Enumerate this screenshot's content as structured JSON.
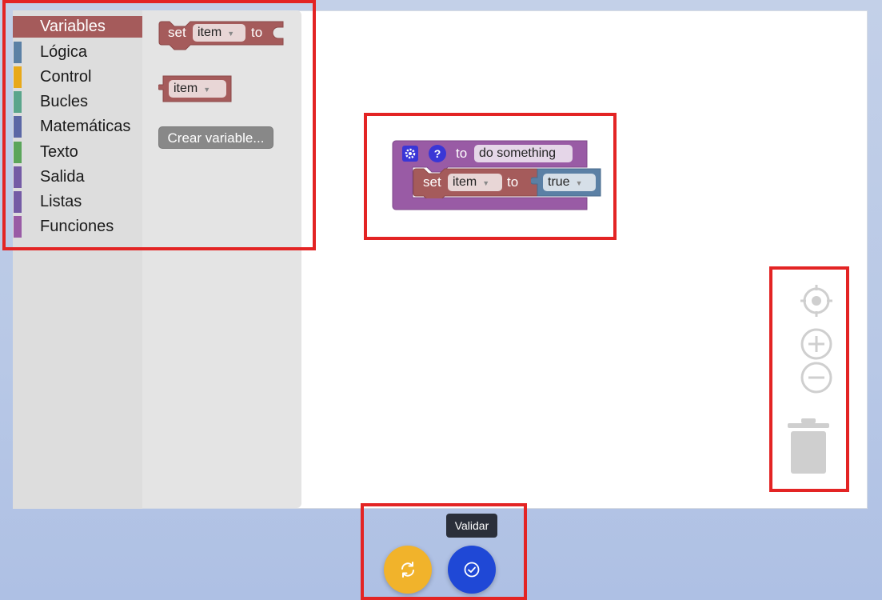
{
  "categories": [
    {
      "label": "Variables",
      "color": "#a55b5b",
      "selected": true
    },
    {
      "label": "Lógica",
      "color": "#5b80a5"
    },
    {
      "label": "Control",
      "color": "#e8a91a"
    },
    {
      "label": "Bucles",
      "color": "#5ba58c"
    },
    {
      "label": "Matemáticas",
      "color": "#5b67a5"
    },
    {
      "label": "Texto",
      "color": "#5ba55b"
    },
    {
      "label": "Salida",
      "color": "#745ba5"
    },
    {
      "label": "Listas",
      "color": "#745ba5"
    },
    {
      "label": "Funciones",
      "color": "#995ba5"
    }
  ],
  "flyout": {
    "set_block": {
      "keyword": "set",
      "variable": "item",
      "to": "to"
    },
    "get_block": {
      "variable": "item"
    },
    "create_variable_button": "Crear variable..."
  },
  "canvas": {
    "function_block": {
      "to": "to",
      "name": "do something",
      "gear_icon": "gear-icon",
      "help_icon": "?"
    },
    "set_block": {
      "keyword": "set",
      "variable": "item",
      "to": "to"
    },
    "boolean_block": {
      "value": "true"
    }
  },
  "colors": {
    "variables": "#a55b5b",
    "procedures": "#995ba5",
    "logic": "#5b80a5",
    "reset_button": "#f1b32b",
    "validate_button": "#1f48d6",
    "highlight": "#e32424"
  },
  "workspace_controls": [
    "recenter-icon",
    "zoom-in-icon",
    "zoom-out-icon",
    "trash-icon"
  ],
  "bottom_bar": {
    "tooltip": "Validar",
    "reset_icon": "refresh-icon",
    "validate_icon": "check-circle-icon"
  }
}
